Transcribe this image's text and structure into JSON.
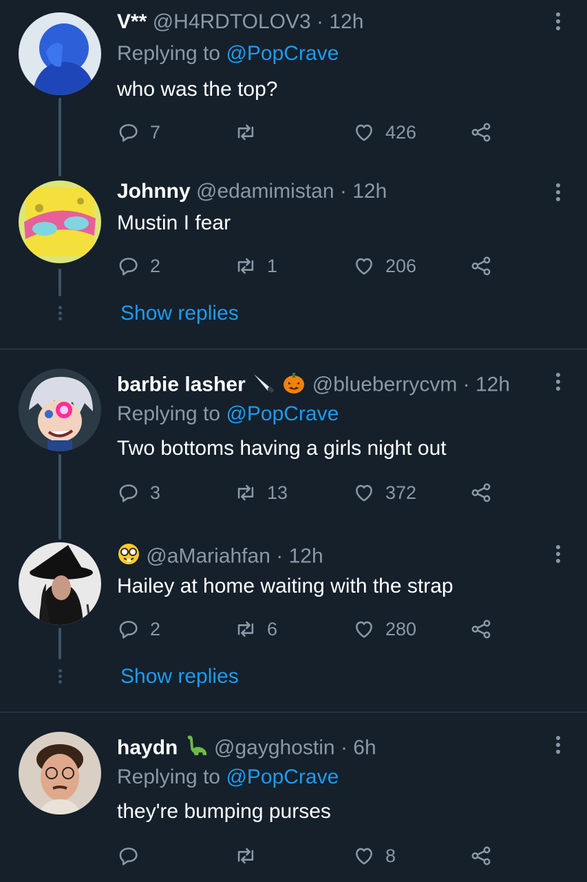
{
  "tweets": [
    {
      "display_name": "V**",
      "handle": "@H4RDTOLOV3",
      "time": "12h",
      "replying_prefix": "Replying to",
      "replying_to": "@PopCrave",
      "text": "who was the top?",
      "replies": "7",
      "retweets": "",
      "likes": "426"
    },
    {
      "display_name": "Johnny",
      "handle": "@edamimistan",
      "time": "12h",
      "text": "Mustin I fear",
      "replies": "2",
      "retweets": "1",
      "likes": "206",
      "show_replies": "Show replies"
    },
    {
      "display_name": "barbie lasher",
      "handle": "@blueberrycvm",
      "time": "12h",
      "replying_prefix": "Replying to",
      "replying_to": "@PopCrave",
      "text": "Two bottoms having a girls night out",
      "replies": "3",
      "retweets": "13",
      "likes": "372"
    },
    {
      "display_name": "",
      "handle": "@aMariahfan",
      "time": "12h",
      "text": "Hailey at home waiting with the strap",
      "replies": "2",
      "retweets": "6",
      "likes": "280",
      "show_replies": "Show replies"
    },
    {
      "display_name": "haydn",
      "handle": "@gayghostin",
      "time": "6h",
      "replying_prefix": "Replying to",
      "replying_to": "@PopCrave",
      "text": "they're bumping purses",
      "replies": "",
      "retweets": "",
      "likes": "8"
    }
  ],
  "separator": "·",
  "colors": {
    "background": "#15202b",
    "link": "#1d9bf0",
    "muted": "#8b98a5",
    "thread": "#3d5466"
  }
}
